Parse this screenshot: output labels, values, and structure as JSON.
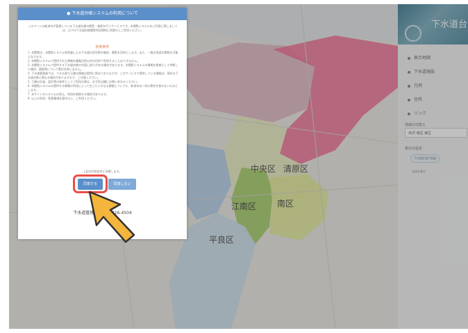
{
  "sidebar": {
    "banner_title": "下水道台",
    "menu_items": [
      "表示地図",
      "下水道施設",
      "凡例",
      "住所",
      "リンク"
    ],
    "area_heading": "地域の切替え",
    "area_select_value": "滝沢 南区 東区",
    "display_heading": "表示の設定",
    "pill_label": "下水道計画平面図",
    "link_label": "全体を表示"
  },
  "map": {
    "districts": [
      "中央区",
      "清原区",
      "江南区",
      "南区",
      "平良区"
    ],
    "colors": {
      "north": "#d9aab9",
      "east": "#ee5c86",
      "central": "#e7eab7",
      "south_green": "#9bc657",
      "south_east": "#dfe98e",
      "west_blue": "#a9c7e5",
      "south_west": "#c6dde9"
    }
  },
  "modal": {
    "title": "下水道台帳システムの利用について",
    "intro": "このページは新潟市が管理している下水道台帳の閲覧・検索を行うサービスです。本閲覧システムのご利用に際しましては、以下の下水道台帳閲覧利用規約に同意の上ご利用ください。",
    "terms_title": "利用条件",
    "terms": [
      "1. 本閲覧は、本閲覧システム利用者による下水道の状況等の確認、閲覧を目的とします。また、一般の用途の閲覧を可能となります。",
      "2. 本閲覧システムで提供された情報を複製目的以外の目的で利用することはできません。",
      "3. 本閲覧システムで提供する下水道台帳の内容に誤りがある場合があります。本閲覧システムの情報を根拠として判断した場合、損害等について責任を負いません。",
      "4. 下水道管理者では、できる限り正確な情報の提供に努めておりますが、このサービスで提供している情報は、現在の下水道台帳と異なる場合がありますので、ご注意ください。",
      "5. 工事の計画、設計等の参考としてご利用の際は、必ず担当課にお問い合わせください。",
      "6. 本閲覧システムの提供する情報の利用によって生じたいかなる損害についても、新潟市は一切の責任を負わないものとします。",
      "7. 本サイトのシステムの停止、利用を制限する場合があります。",
      "8. 以上の利用・免責事項を遵守の上、ご利用ください。"
    ],
    "agree_note": "上記の利用条件に同意します。",
    "agree_label": "同意する",
    "disagree_label": "同意しない",
    "contact_label": "お問い合わせ先",
    "contact": "下水道管理課　025-226-4504"
  }
}
